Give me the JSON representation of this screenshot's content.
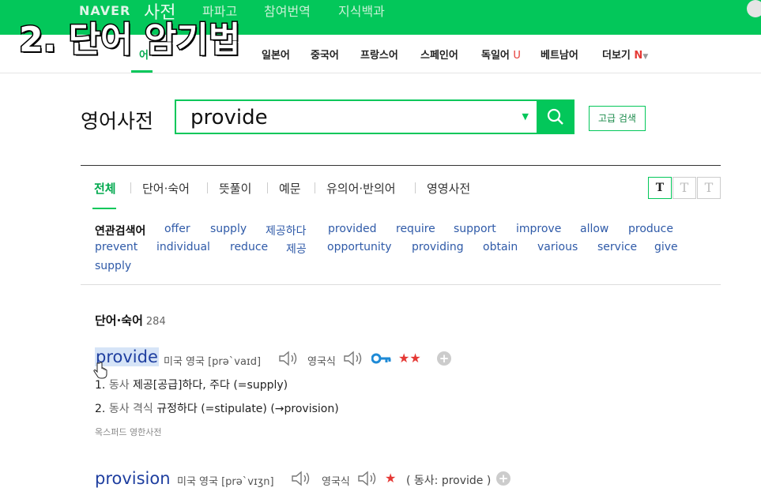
{
  "overlay": {
    "title": "2. 단어 암기법"
  },
  "header": {
    "brand": "NAVER",
    "service": "사전",
    "links": [
      "파파고",
      "참여번역",
      "지식백과"
    ]
  },
  "langs": {
    "items": [
      "일본어",
      "중국어",
      "프랑스어",
      "스페인어",
      "독일어",
      "베트남어",
      "더보기"
    ],
    "badge_u": "U",
    "badge_n": "N",
    "partial_first": "어"
  },
  "search": {
    "dict_title": "영어사전",
    "query": "provide",
    "advanced_label": "고급 검색"
  },
  "tabs": [
    "전체",
    "단어·숙어",
    "뜻풀이",
    "예문",
    "유의어·반의어",
    "영영사전"
  ],
  "font_size_buttons": [
    "T",
    "T",
    "T"
  ],
  "related": {
    "label": "연관검색어",
    "row1": [
      "offer",
      "supply",
      "제공하다",
      "provided",
      "require",
      "support",
      "improve",
      "allow",
      "produce"
    ],
    "row2": [
      "prevent",
      "individual",
      "reduce",
      "제공",
      "opportunity",
      "providing",
      "obtain",
      "various",
      "service",
      "give"
    ],
    "row3": [
      "supply"
    ]
  },
  "results": {
    "section_label": "단어·숙어",
    "count": "284",
    "entry1": {
      "word": "provide",
      "pron_us": "미국 영국 [prə`vaɪd]",
      "pron_uk_label": "영국식",
      "stars": "★★",
      "def1_num": "1.",
      "def1_pos": "동사",
      "def1_text": "제공[공급]하다, 주다 (=supply)",
      "def2_num": "2.",
      "def2_pos": "동사 격식",
      "def2_text": "규정하다 (=stipulate) (→provision)",
      "source": "옥스퍼드 영한사전"
    },
    "entry2": {
      "word": "provision",
      "pron": "미국 영국 [prə`vɪʒn]",
      "pron_uk_label": "영국식",
      "stars": "★",
      "note": "( 동사: provide )"
    }
  },
  "colors": {
    "accent": "#03c75a",
    "link": "#2f5aa8",
    "star": "#e53935"
  }
}
